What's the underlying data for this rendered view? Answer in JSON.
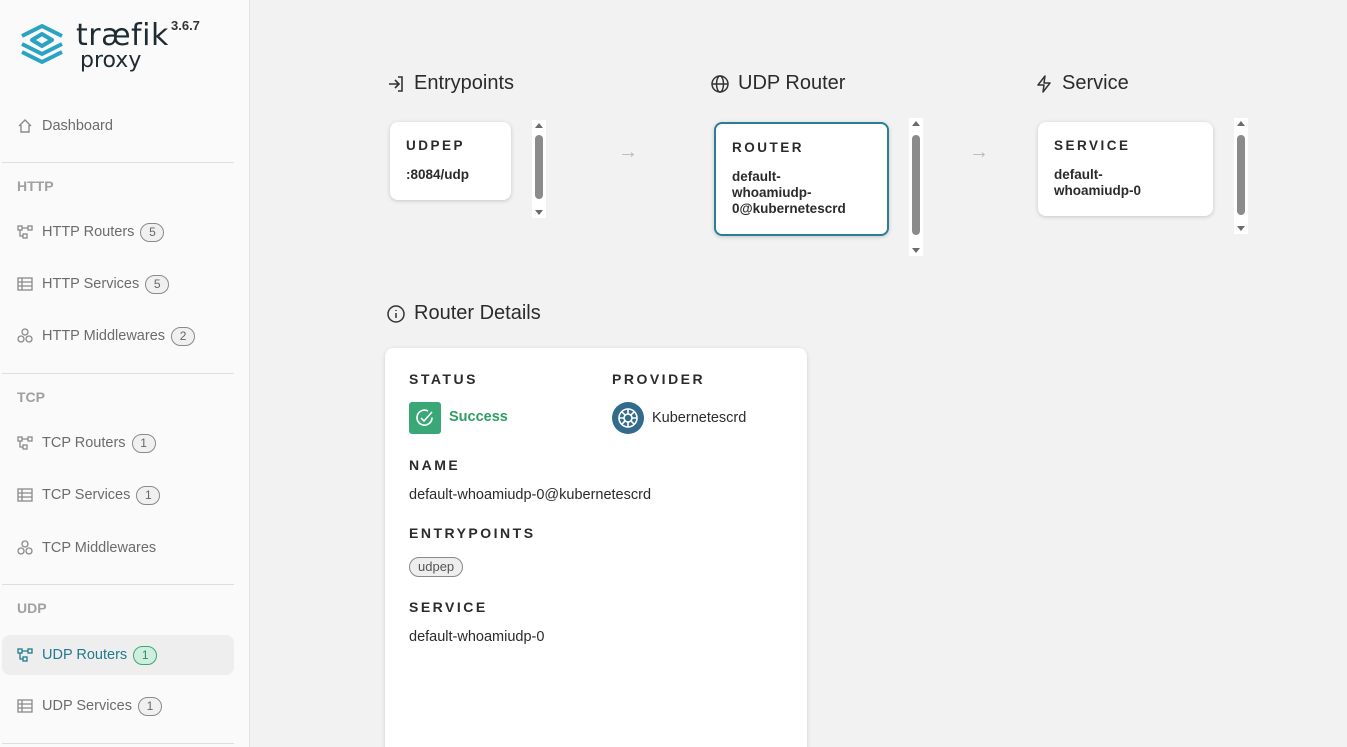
{
  "app": {
    "brand_top": "træfik",
    "brand_bottom": "proxy",
    "version": "3.6.7"
  },
  "sidebar": {
    "dashboard": "Dashboard",
    "sections": {
      "http": "HTTP",
      "tcp": "TCP",
      "udp": "UDP"
    },
    "items": {
      "http_routers": {
        "label": "HTTP Routers",
        "count": "5"
      },
      "http_services": {
        "label": "HTTP Services",
        "count": "5"
      },
      "http_middlewares": {
        "label": "HTTP Middlewares",
        "count": "2"
      },
      "tcp_routers": {
        "label": "TCP Routers",
        "count": "1"
      },
      "tcp_services": {
        "label": "TCP Services",
        "count": "1"
      },
      "tcp_middlewares": {
        "label": "TCP Middlewares"
      },
      "udp_routers": {
        "label": "UDP Routers",
        "count": "1"
      },
      "udp_services": {
        "label": "UDP Services",
        "count": "1"
      }
    }
  },
  "flow": {
    "entrypoints": {
      "title": "Entrypoints",
      "card_label": "UDPEP",
      "card_value": ":8084/udp"
    },
    "router": {
      "title": "UDP Router",
      "card_label": "ROUTER",
      "card_value": "default-whoamiudp-0@kubernetescrd"
    },
    "service": {
      "title": "Service",
      "card_label": "SERVICE",
      "card_value": "default-whoamiudp-0"
    }
  },
  "details": {
    "title": "Router Details",
    "status_label": "STATUS",
    "status_value": "Success",
    "provider_label": "PROVIDER",
    "provider_value": "Kubernetescrd",
    "name_label": "NAME",
    "name_value": "default-whoamiudp-0@kubernetescrd",
    "entrypoints_label": "ENTRYPOINTS",
    "entrypoints_chip": "udpep",
    "service_label": "SERVICE",
    "service_value": "default-whoamiudp-0"
  },
  "colors": {
    "accent": "#217990",
    "success": "#3aa876",
    "provider": "#336b8c"
  }
}
